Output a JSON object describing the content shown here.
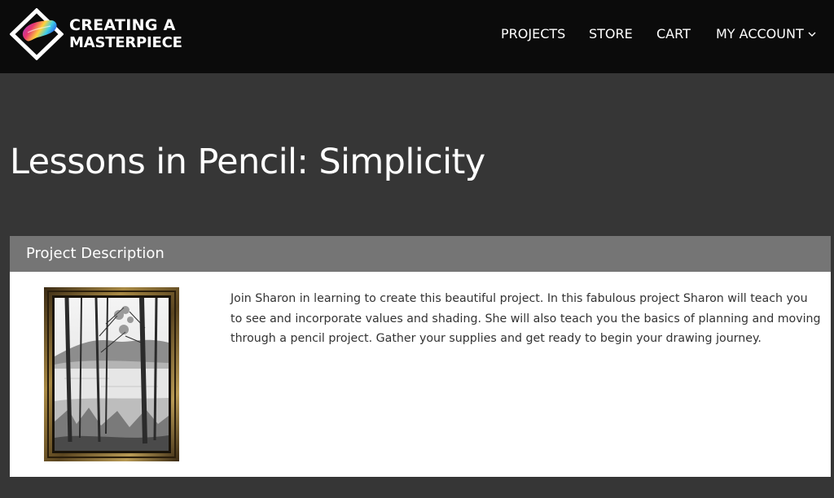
{
  "header": {
    "logo": {
      "line1": "CREATING A",
      "line2": "MASTERPIECE",
      "icon": "brand-diamond-icon"
    },
    "nav": [
      {
        "label": "PROJECTS"
      },
      {
        "label": "STORE"
      },
      {
        "label": "CART"
      },
      {
        "label": "MY ACCOUNT",
        "icon": "chevron-down-icon"
      }
    ]
  },
  "page": {
    "title": "Lessons in Pencil: Simplicity"
  },
  "project": {
    "section_label": "Project Description",
    "description": "Join Sharon in learning to create this beautiful project. In this fabulous project Sharon will teach you to see and incorporate values and shading. She will also teach you the basics of planning and moving through a pencil project. Gather your supplies and get ready to begin your drawing journey."
  },
  "colors": {
    "header_bg": "#0b0b0b",
    "page_bg": "#363636",
    "section_header_bg": "#757575",
    "panel_bg": "#ffffff",
    "text_light": "#ffffff",
    "text_dark": "#333333"
  }
}
